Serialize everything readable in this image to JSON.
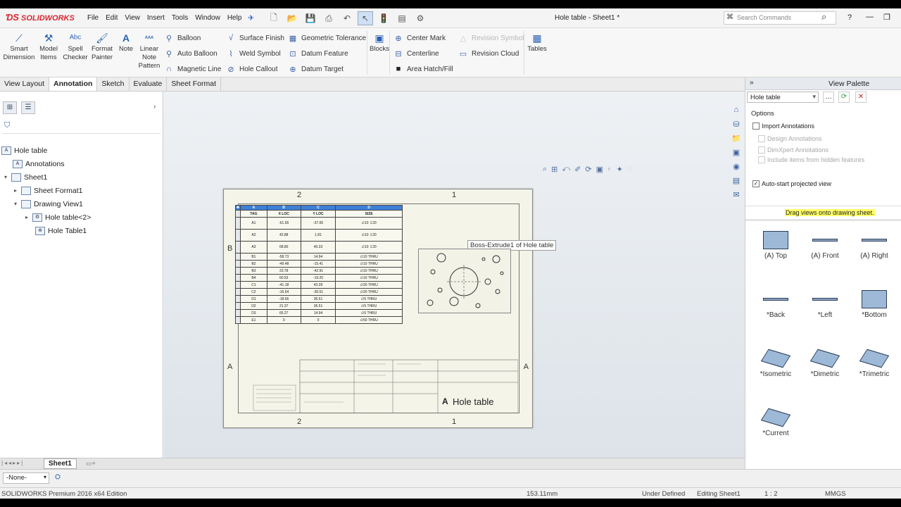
{
  "app": {
    "brand": "SOLIDWORKS",
    "title": "Hole table - Sheet1 *"
  },
  "menu": [
    "File",
    "Edit",
    "View",
    "Insert",
    "Tools",
    "Window",
    "Help"
  ],
  "search": {
    "placeholder": "Search Commands"
  },
  "ribbon": {
    "big": [
      {
        "label": "Smart\nDimension",
        "icon": "smart-dimension-icon"
      },
      {
        "label": "Model\nItems",
        "icon": "model-items-icon"
      },
      {
        "label": "Spell\nChecker",
        "icon": "spell-checker-icon"
      },
      {
        "label": "Format\nPainter",
        "icon": "format-painter-icon"
      },
      {
        "label": "Note",
        "icon": "note-icon"
      },
      {
        "label": "Linear\nNote\nPattern",
        "icon": "linear-note-pattern-icon"
      }
    ],
    "col1": [
      "Balloon",
      "Auto Balloon",
      "Magnetic Line"
    ],
    "col2": [
      "Surface Finish",
      "Weld Symbol",
      "Hole Callout"
    ],
    "col3": [
      "Geometric Tolerance",
      "Datum Feature",
      "Datum Target"
    ],
    "blocks": "Blocks",
    "col4": [
      "Center Mark",
      "Centerline",
      "Area Hatch/Fill"
    ],
    "col5": [
      "Revision Symbol",
      "Revision Cloud"
    ],
    "tables": "Tables"
  },
  "tabs": [
    "View Layout",
    "Annotation",
    "Sketch",
    "Evaluate",
    "Sheet Format"
  ],
  "active_tab": "Annotation",
  "tree": [
    {
      "label": "Hole table",
      "level": 0
    },
    {
      "label": "Annotations",
      "level": 1
    },
    {
      "label": "Sheet1",
      "level": 1
    },
    {
      "label": "Sheet Format1",
      "level": 2
    },
    {
      "label": "Drawing View1",
      "level": 2
    },
    {
      "label": "Hole table<2>",
      "level": 3
    },
    {
      "label": "Hole Table1",
      "level": 3
    }
  ],
  "sheet": {
    "zones_top": [
      "2",
      "1"
    ],
    "zones_side": [
      "B",
      "A"
    ],
    "table_letters": [
      "A",
      "B",
      "C",
      "D"
    ],
    "table_headers": [
      "TAG",
      "X LOC",
      "Y LOC",
      "SIZE"
    ],
    "table_rows": [
      [
        "A1",
        "-61.65",
        "-37.06",
        "∅10 ↧20"
      ],
      [
        "A2",
        "42.88",
        "1.81",
        "∅10 ↧20"
      ],
      [
        "A3",
        "68.80",
        "40.33",
        "∅10 ↧20"
      ],
      [
        "B1",
        "-58.73",
        "14.94",
        "∅10 THRU"
      ],
      [
        "B2",
        "-49.48",
        "-15.41",
        "∅10 THRU"
      ],
      [
        "B3",
        "23.78",
        "-42.91",
        "∅10 THRU"
      ],
      [
        "B4",
        "60.53",
        "-19.20",
        "∅10 THRU"
      ],
      [
        "C1",
        "-41.18",
        "43.39",
        "∅20 THRU"
      ],
      [
        "C2",
        "-16.64",
        "-36.51",
        "∅20 THRU"
      ],
      [
        "D1",
        "-18.66",
        "36.51",
        "∅5 THRU"
      ],
      [
        "D2",
        "21.37",
        "36.51",
        "∅5 THRU"
      ],
      [
        "D3",
        "65.27",
        "14.94",
        "∅5 THRU"
      ],
      [
        "E1",
        "0",
        "0",
        "∅50 THRU"
      ]
    ],
    "tooltip": "Boss-Extrude1 of Hole table",
    "title_block_name": "Hole table",
    "size_letter": "A"
  },
  "palette": {
    "title": "View Palette",
    "selected": "Hole table",
    "options_label": "Options",
    "import_annotations": "Import Annotations",
    "design_annotations": "Design Annotations",
    "dimxpert_annotations": "DimXpert Annotations",
    "hidden_features": "Include items from hidden features",
    "auto_start": "Auto-start projected view",
    "drag_hint": "Drag views onto drawing sheet.",
    "views": [
      "(A) Top",
      "(A) Front",
      "(A) Right",
      "*Back",
      "*Left",
      "*Bottom",
      "*Isometric",
      "*Dimetric",
      "*Trimetric",
      "*Current"
    ]
  },
  "sheet_tab": "Sheet1",
  "layer": "-None-",
  "status": {
    "edition": "SOLIDWORKS Premium 2016 x64 Edition",
    "coord": "153.11mm",
    "state": "Under Defined",
    "editing": "Editing Sheet1",
    "scale": "1 : 2",
    "units": "MMGS"
  },
  "colors": {
    "accent": "#3e80d8",
    "brand": "#d8262f",
    "highlight": "#ffff66"
  }
}
